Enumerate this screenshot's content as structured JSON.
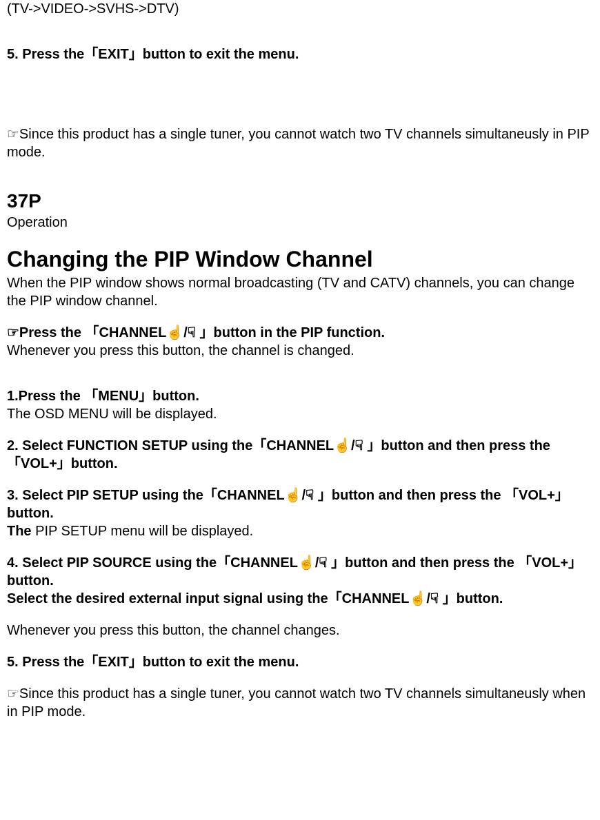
{
  "lines": {
    "l1": "(TV->VIDEO->SVHS->DTV)",
    "l2": "5. Press the「EXIT」button to exit the menu.",
    "l3": "☞Since this product has a single tuner, you cannot watch two TV channels simultaneusly in PIP mode.",
    "l4": "37P",
    "l5": "Operation",
    "l6": "Changing the PIP Window Channel",
    "l7": " When the PIP window shows normal broadcasting (TV and CATV) channels, you can change the PIP window channel.",
    "l8a": "☞Press the  「CHANNEL",
    "l8b": "/",
    "l8c": " 」button in the PIP function.",
    "l9": " Whenever you press this button, the channel is changed.",
    "l10": "1.Press the 「MENU」button.",
    "l11": " The OSD MENU will be displayed.",
    "l12a": "2. Select FUNCTION SETUP using the「CHANNEL",
    "l12b": "/",
    "l12c": " 」button and then press the 「VOL+」button.",
    "l13a": "3. Select PIP SETUP using the「CHANNEL",
    "l13b": "/",
    "l13c": " 」button and then press the 「VOL+」button.",
    "l14a": " The",
    "l14b": " PIP SETUP menu will be displayed.",
    "l15a": "4.  Select PIP SOURCE using the「CHANNEL",
    "l15b": "/",
    "l15c": " 」button and then press the 「VOL+」button.",
    "l16a": " Select the desired external input signal using the「CHANNEL",
    "l16b": "/",
    "l16c": " 」button.",
    "l17": " Whenever you press this button, the channel changes.",
    "l18": "5. Press the「EXIT」button to exit the menu.",
    "l19": "☞Since this product has a single tuner, you cannot watch two TV channels simultaneusly when in PIP mode.",
    "iconUp": "☝",
    "iconDown": "☟"
  }
}
